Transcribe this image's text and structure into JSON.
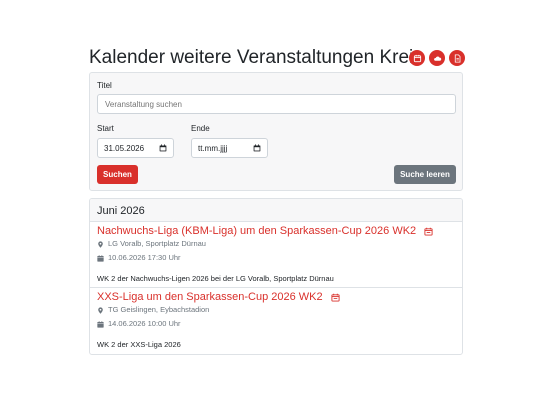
{
  "page": {
    "title": "Kalender weitere Veranstaltungen Kreis",
    "accent_color": "#d9302b",
    "header_icons": [
      {
        "icon": "calendar-icon"
      },
      {
        "icon": "cloud-icon"
      },
      {
        "icon": "pdf-file-icon"
      }
    ]
  },
  "filter": {
    "title_label": "Titel",
    "title_placeholder": "Veranstaltung suchen",
    "start_label": "Start",
    "start_value": "31.05.2026",
    "end_label": "Ende",
    "end_placeholder": "tt.mm.jjjj",
    "search_button": "Suchen",
    "clear_button": "Suche leeren"
  },
  "results": {
    "month": "Juni 2026",
    "events": [
      {
        "title": "Nachwuchs-Liga (KBM-Liga) um den Sparkassen-Cup 2026 WK2",
        "location": "LG Voralb, Sportplatz Dürnau",
        "datetime": "10.06.2026 17:30 Uhr",
        "description": "WK 2 der Nachwuchs-Ligen 2026 bei der LG Voralb, Sportplatz Dürnau"
      },
      {
        "title": "XXS-Liga um den Sparkassen-Cup 2026 WK2",
        "location": "TG Geislingen, Eybachstadion",
        "datetime": "14.06.2026 10:00 Uhr",
        "description": "WK 2 der XXS-Liga 2026"
      }
    ]
  }
}
